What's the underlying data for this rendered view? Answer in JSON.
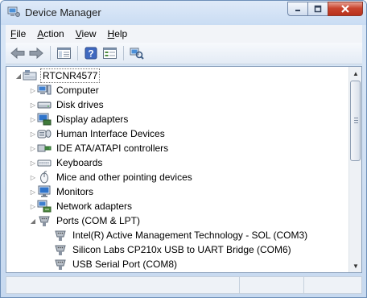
{
  "window": {
    "title": "Device Manager"
  },
  "menu": [
    {
      "label": "File",
      "mnemonic": "F",
      "rest": "ile"
    },
    {
      "label": "Action",
      "mnemonic": "A",
      "rest": "ction"
    },
    {
      "label": "View",
      "mnemonic": "V",
      "rest": "iew"
    },
    {
      "label": "Help",
      "mnemonic": "H",
      "rest": "elp"
    }
  ],
  "toolbar": {
    "buttons": [
      "back-icon",
      "forward-icon",
      "show-hide-console-tree-icon",
      "help-icon",
      "properties-icon",
      "scan-hardware-changes-icon"
    ]
  },
  "tree": {
    "root": "RTCNR4577",
    "categories": [
      {
        "label": "Computer",
        "icon": "computer-icon"
      },
      {
        "label": "Disk drives",
        "icon": "disk-drive-icon"
      },
      {
        "label": "Display adapters",
        "icon": "display-adapter-icon"
      },
      {
        "label": "Human Interface Devices",
        "icon": "hid-icon"
      },
      {
        "label": "IDE ATA/ATAPI controllers",
        "icon": "ide-controller-icon"
      },
      {
        "label": "Keyboards",
        "icon": "keyboard-icon"
      },
      {
        "label": "Mice and other pointing devices",
        "icon": "mouse-icon"
      },
      {
        "label": "Monitors",
        "icon": "monitor-icon"
      },
      {
        "label": "Network adapters",
        "icon": "network-adapter-icon"
      },
      {
        "label": "Ports (COM & LPT)",
        "icon": "port-icon",
        "expanded": true
      }
    ],
    "ports": [
      "Intel(R) Active Management Technology - SOL (COM3)",
      "Silicon Labs CP210x USB to UART Bridge (COM6)",
      "USB Serial Port (COM8)"
    ]
  },
  "colors": {
    "frame": "#c7d9ef",
    "close_button": "#c9452f",
    "selection_border": "#777777"
  }
}
